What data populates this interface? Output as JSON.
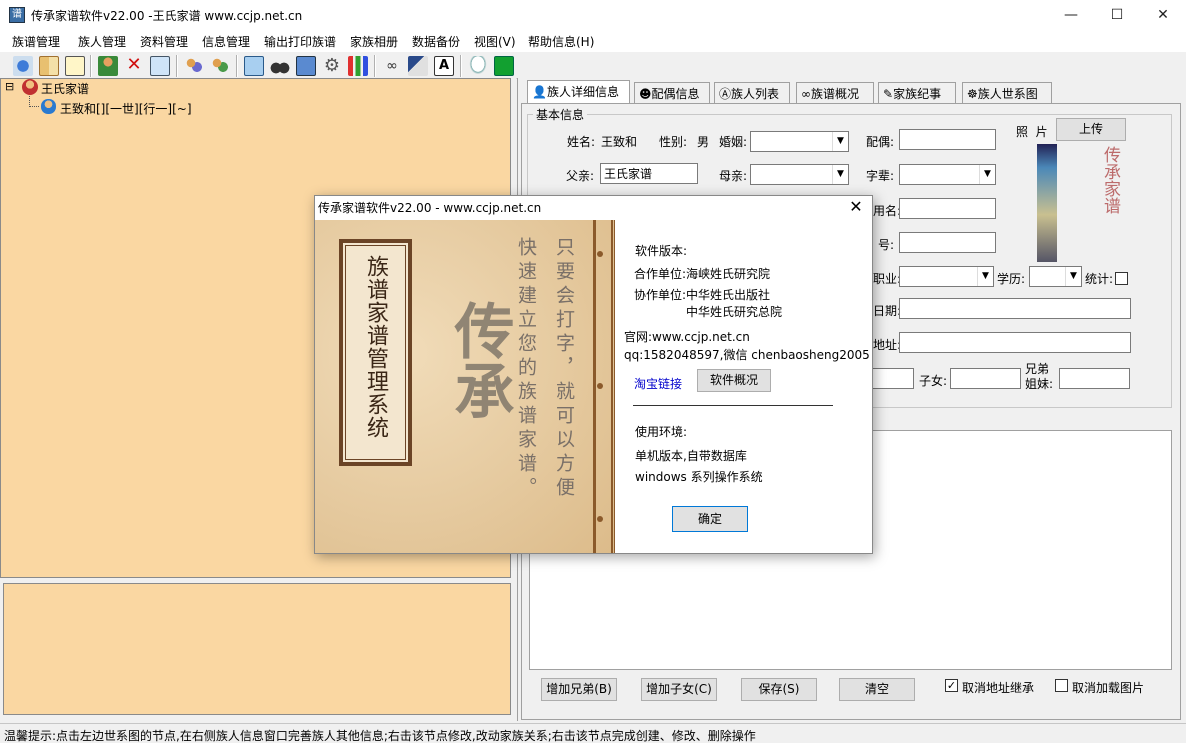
{
  "window": {
    "title": "传承家谱软件v22.00 -王氏家谱 www.ccjp.net.cn",
    "minimize": "—",
    "maximize": "☐",
    "close": "✕"
  },
  "menu": [
    "族谱管理",
    "族人管理",
    "资料管理",
    "信息管理",
    "输出打印族谱",
    "家族相册",
    "数据备份",
    "视图(V)",
    "帮助信息(H)"
  ],
  "toolbar_icons": [
    "tree-icon",
    "book-icon",
    "chart-icon",
    "person-icon",
    "delete-icon",
    "page-icon",
    "people-icon",
    "people-search-icon",
    "copy-icon",
    "binoculars-icon",
    "pages-icon",
    "gear-icon",
    "bar-chart-icon",
    "glasses-icon",
    "books-icon",
    "text-icon",
    "message-icon",
    "exit-icon"
  ],
  "tree": {
    "root": "王氏家谱",
    "toggle": "⊟",
    "child": "王致和[][一世][行一][~]"
  },
  "tabs": [
    "族人详细信息",
    "配偶信息",
    "族人列表",
    "族谱概况",
    "家族纪事",
    "族人世系图"
  ],
  "form": {
    "group_label": "基本信息",
    "name_label": "姓名:",
    "name_value": "王致和",
    "gender_label": "性别:",
    "gender_value": "男",
    "marriage_label": "婚姻:",
    "spouse_label": "配偶:",
    "father_label": "父亲:",
    "father_value": "王氏家谱",
    "mother_label": "母亲:",
    "generation_label": "字辈:",
    "alias_label": "用名:",
    "number_label": "号:",
    "job_label": "职业:",
    "education_label": "学历:",
    "stats_label": "统计:",
    "date_label": "日期:",
    "address_label": "地址:",
    "children_label": "子女:",
    "siblings_label": "兄弟\n姐妹:",
    "photo_label": "照  片",
    "upload_button": "上传",
    "photo_seal": "传承家谱"
  },
  "buttons": {
    "add_sibling": "增加兄弟(B)",
    "add_child": "增加子女(C)",
    "save": "保存(S)",
    "clear": "清空",
    "cancel_address": "取消地址继承",
    "cancel_image": "取消加载图片",
    "cancel_address_checked": true,
    "cancel_image_checked": false
  },
  "status": "温馨提示:点击左边世系图的节点,在右侧族人信息窗口完善族人其他信息;右击该节点修改,改动家族关系;右击该节点完成创建、修改、删除操作",
  "dialog": {
    "title": "传承家谱软件v22.00 - www.ccjp.net.cn",
    "close": "✕",
    "book_title": "族谱家谱管理系统",
    "calligraphy": "传承",
    "slogan_col1": "只要会打字，就可以方便",
    "slogan_col2": "快速建立您的族谱家谱。",
    "version_label": "软件版本:",
    "partner_label": "合作单位:海峡姓氏研究院",
    "cooperate_label": "协作单位:中华姓氏出版社",
    "cooperate_label2": "中华姓氏研究总院",
    "website": "官网:www.ccjp.net.cn",
    "contact": "qq:1582048597,微信 chenbaosheng2005",
    "taobao_link": "淘宝链接",
    "overview_button": "软件概况",
    "env_label": "使用环境:",
    "env1": "单机版本,自带数据库",
    "env2": "windows 系列操作系统",
    "ok_button": "确定"
  }
}
